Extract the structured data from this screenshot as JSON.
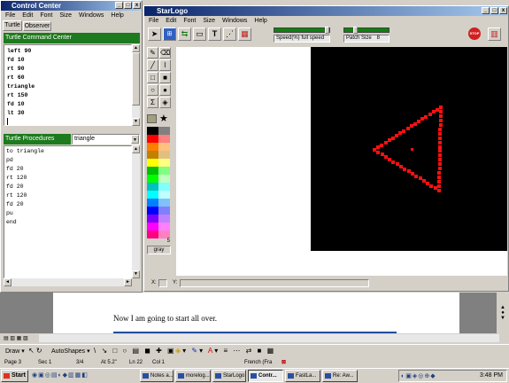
{
  "control_center": {
    "title": "Control Center",
    "menu": [
      "File",
      "Edit",
      "Font",
      "Size",
      "Windows",
      "Help"
    ],
    "tabs": [
      "Turtle",
      "Observer"
    ],
    "command_center_title": "Turtle Command Center",
    "commands": [
      "left 90",
      "fd 10",
      "rt 90",
      "rt 60",
      "triangle",
      "rt 150",
      "fd 10",
      "lt 30"
    ],
    "procedures_title": "Turtle Procedures",
    "procedure_select": "triangle",
    "procedures": [
      "to triangle",
      "pd",
      "fd 20",
      "rt 120",
      "fd 20",
      "rt 120",
      "fd 20",
      "pu",
      "end"
    ]
  },
  "starlogo": {
    "title": "StarLogo",
    "menu": [
      "File",
      "Edit",
      "Font",
      "Size",
      "Windows",
      "Help"
    ],
    "speed_label": "Speed(%)",
    "speed_value": "full speed",
    "patch_label": "Patch Size",
    "patch_value": "8",
    "color_name": "gray",
    "color_number": "5",
    "coord_x_label": "X:",
    "coord_y_label": "Y:",
    "stop_label": "STOP",
    "colors": {
      "canvas": "#000000",
      "turtle_path": "#ff1010"
    },
    "palette": [
      [
        "#000000",
        "#808080"
      ],
      [
        "#ff0000",
        "#ff8080"
      ],
      [
        "#ff8000",
        "#ffc080"
      ],
      [
        "#c08000",
        "#e0c080"
      ],
      [
        "#ffff00",
        "#ffff80"
      ],
      [
        "#00c000",
        "#80ff80"
      ],
      [
        "#00ff00",
        "#c0ffc0"
      ],
      [
        "#00c0c0",
        "#80ffff"
      ],
      [
        "#00ffff",
        "#c0ffff"
      ],
      [
        "#0080ff",
        "#80c0ff"
      ],
      [
        "#0000ff",
        "#8080ff"
      ],
      [
        "#8000ff",
        "#c080ff"
      ],
      [
        "#ff00ff",
        "#ff80ff"
      ],
      [
        "#ff0080",
        "#ff80c0"
      ]
    ]
  },
  "word": {
    "document_text": "Now I am going to start all over.",
    "draw_label": "Draw",
    "autoshapes_label": "AutoShapes",
    "status": {
      "page": "Page 3",
      "sec": "Sec 1",
      "pages": "3/4",
      "at": "At 5.2\"",
      "ln": "Ln 22",
      "col": "Col 1",
      "language": "French (Fra"
    }
  },
  "taskbar": {
    "start_label": "Start",
    "items": [
      "Notes a...",
      "morelog...",
      "StarLogo",
      "Contr...",
      "FastLa...",
      "Re: Aw..."
    ],
    "clock": "3:48 PM"
  }
}
